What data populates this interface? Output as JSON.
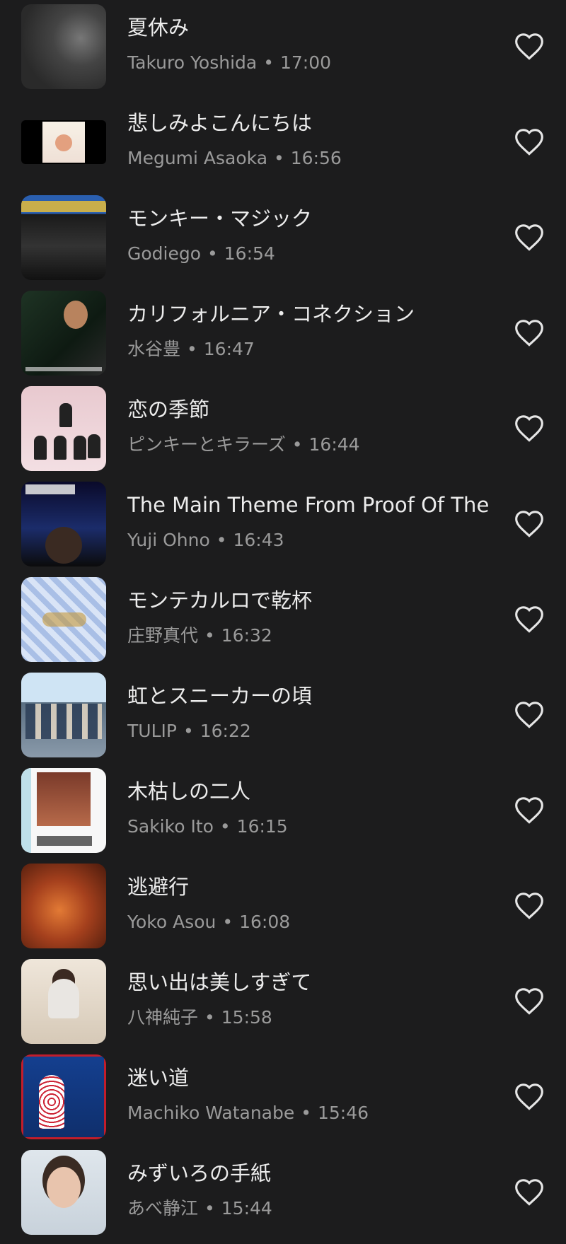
{
  "recent_tracks": [
    {
      "title": "夏休み",
      "artist": "Takuro Yoshida",
      "time": "17:00",
      "thumbnail": "album-cover-takuro-yoshida"
    },
    {
      "title": "悲しみよこんにちは",
      "artist": "Megumi Asaoka",
      "time": "16:56",
      "thumbnail": "album-cover-megumi-asaoka"
    },
    {
      "title": "モンキー・マジック",
      "artist": "Godiego",
      "time": "16:54",
      "thumbnail": "album-cover-godiego"
    },
    {
      "title": "カリフォルニア・コネクション",
      "artist": "水谷豊",
      "time": "16:47",
      "thumbnail": "album-cover-yutaka-mizutani"
    },
    {
      "title": "恋の季節",
      "artist": "ピンキーとキラーズ",
      "time": "16:44",
      "thumbnail": "album-cover-pinky-and-killers"
    },
    {
      "title": "The Main Theme From Proof Of The",
      "artist": "Yuji Ohno",
      "time": "16:43",
      "thumbnail": "album-cover-yuji-ohno"
    },
    {
      "title": "モンテカルロで乾杯",
      "artist": "庄野真代",
      "time": "16:32",
      "thumbnail": "album-cover-mayo-shono"
    },
    {
      "title": "虹とスニーカーの頃",
      "artist": "TULIP",
      "time": "16:22",
      "thumbnail": "album-cover-tulip"
    },
    {
      "title": "木枯しの二人",
      "artist": "Sakiko Ito",
      "time": "16:15",
      "thumbnail": "album-cover-sakiko-ito"
    },
    {
      "title": "逃避行",
      "artist": "Yoko Asou",
      "time": "16:08",
      "thumbnail": "album-cover-yoko-asou"
    },
    {
      "title": "思い出は美しすぎて",
      "artist": "八神純子",
      "time": "15:58",
      "thumbnail": "album-cover-junko-yagami"
    },
    {
      "title": "迷い道",
      "artist": "Machiko Watanabe",
      "time": "15:46",
      "thumbnail": "album-cover-machiko-watanabe"
    },
    {
      "title": "みずいろの手紙",
      "artist": "あべ静江",
      "time": "15:44",
      "thumbnail": "album-cover-shizue-abe"
    }
  ],
  "separator": "•",
  "icons": {
    "like": "heart-outline-icon"
  },
  "colors": {
    "background": "#1c1c1d",
    "title_text": "#ececec",
    "subtitle_text": "#9a9a9a",
    "icon": "#e6e6e6"
  }
}
